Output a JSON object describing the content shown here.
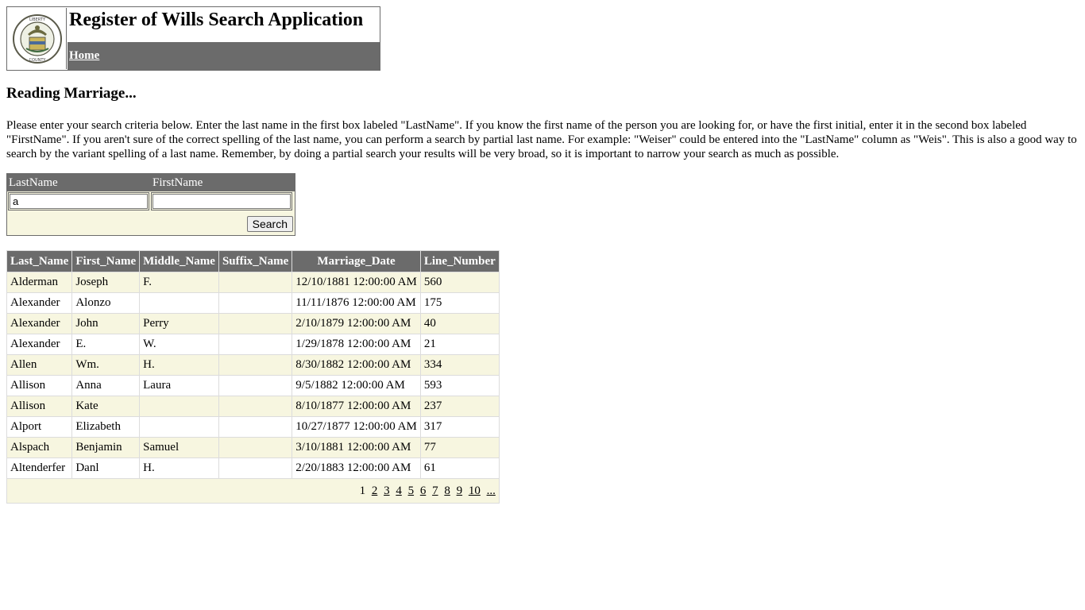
{
  "header": {
    "title": "Register of Wills Search Application",
    "nav_home": "Home",
    "seal_text": "LIBERTY · INDEPENDENCE · BERKS · COUNTY · PENNSYLVANIA"
  },
  "page": {
    "heading": "Reading Marriage...",
    "instructions": "Please enter your search criteria below. Enter the last name in the first box labeled \"LastName\". If you know the first name of the person you are looking for, or have the first initial, enter it in the second box labeled \"FirstName\". If you aren't sure of the correct spelling of the last name, you can perform a search by partial last name. For example: \"Weiser\" could be entered into the \"LastName\" column as \"Weis\". This is also a good way to search by the variant spelling of a last name. Remember, by doing a partial search your results will be very broad, so it is important to narrow your search as much as possible."
  },
  "search": {
    "lastname_label": "LastName",
    "firstname_label": "FirstName",
    "lastname_value": "a",
    "firstname_value": "",
    "button_label": "Search"
  },
  "results": {
    "columns": [
      "Last_Name",
      "First_Name",
      "Middle_Name",
      "Suffix_Name",
      "Marriage_Date",
      "Line_Number"
    ],
    "rows": [
      [
        "Alderman",
        "Joseph",
        "F.",
        "",
        "12/10/1881 12:00:00 AM",
        "560"
      ],
      [
        "Alexander",
        "Alonzo",
        "",
        "",
        "11/11/1876 12:00:00 AM",
        "175"
      ],
      [
        "Alexander",
        "John",
        "Perry",
        "",
        "2/10/1879 12:00:00 AM",
        "40"
      ],
      [
        "Alexander",
        "E.",
        "W.",
        "",
        "1/29/1878 12:00:00 AM",
        "21"
      ],
      [
        "Allen",
        "Wm.",
        "H.",
        "",
        "8/30/1882 12:00:00 AM",
        "334"
      ],
      [
        "Allison",
        "Anna",
        "Laura",
        "",
        "9/5/1882 12:00:00 AM",
        "593"
      ],
      [
        "Allison",
        "Kate",
        "",
        "",
        "8/10/1877 12:00:00 AM",
        "237"
      ],
      [
        "Alport",
        "Elizabeth",
        "",
        "",
        "10/27/1877 12:00:00 AM",
        "317"
      ],
      [
        "Alspach",
        "Benjamin",
        "Samuel",
        "",
        "3/10/1881 12:00:00 AM",
        "77"
      ],
      [
        "Altenderfer",
        "Danl",
        "H.",
        "",
        "2/20/1883 12:00:00 AM",
        "61"
      ]
    ],
    "pager": {
      "current": "1",
      "pages": [
        "2",
        "3",
        "4",
        "5",
        "6",
        "7",
        "8",
        "9",
        "10",
        "..."
      ]
    }
  }
}
